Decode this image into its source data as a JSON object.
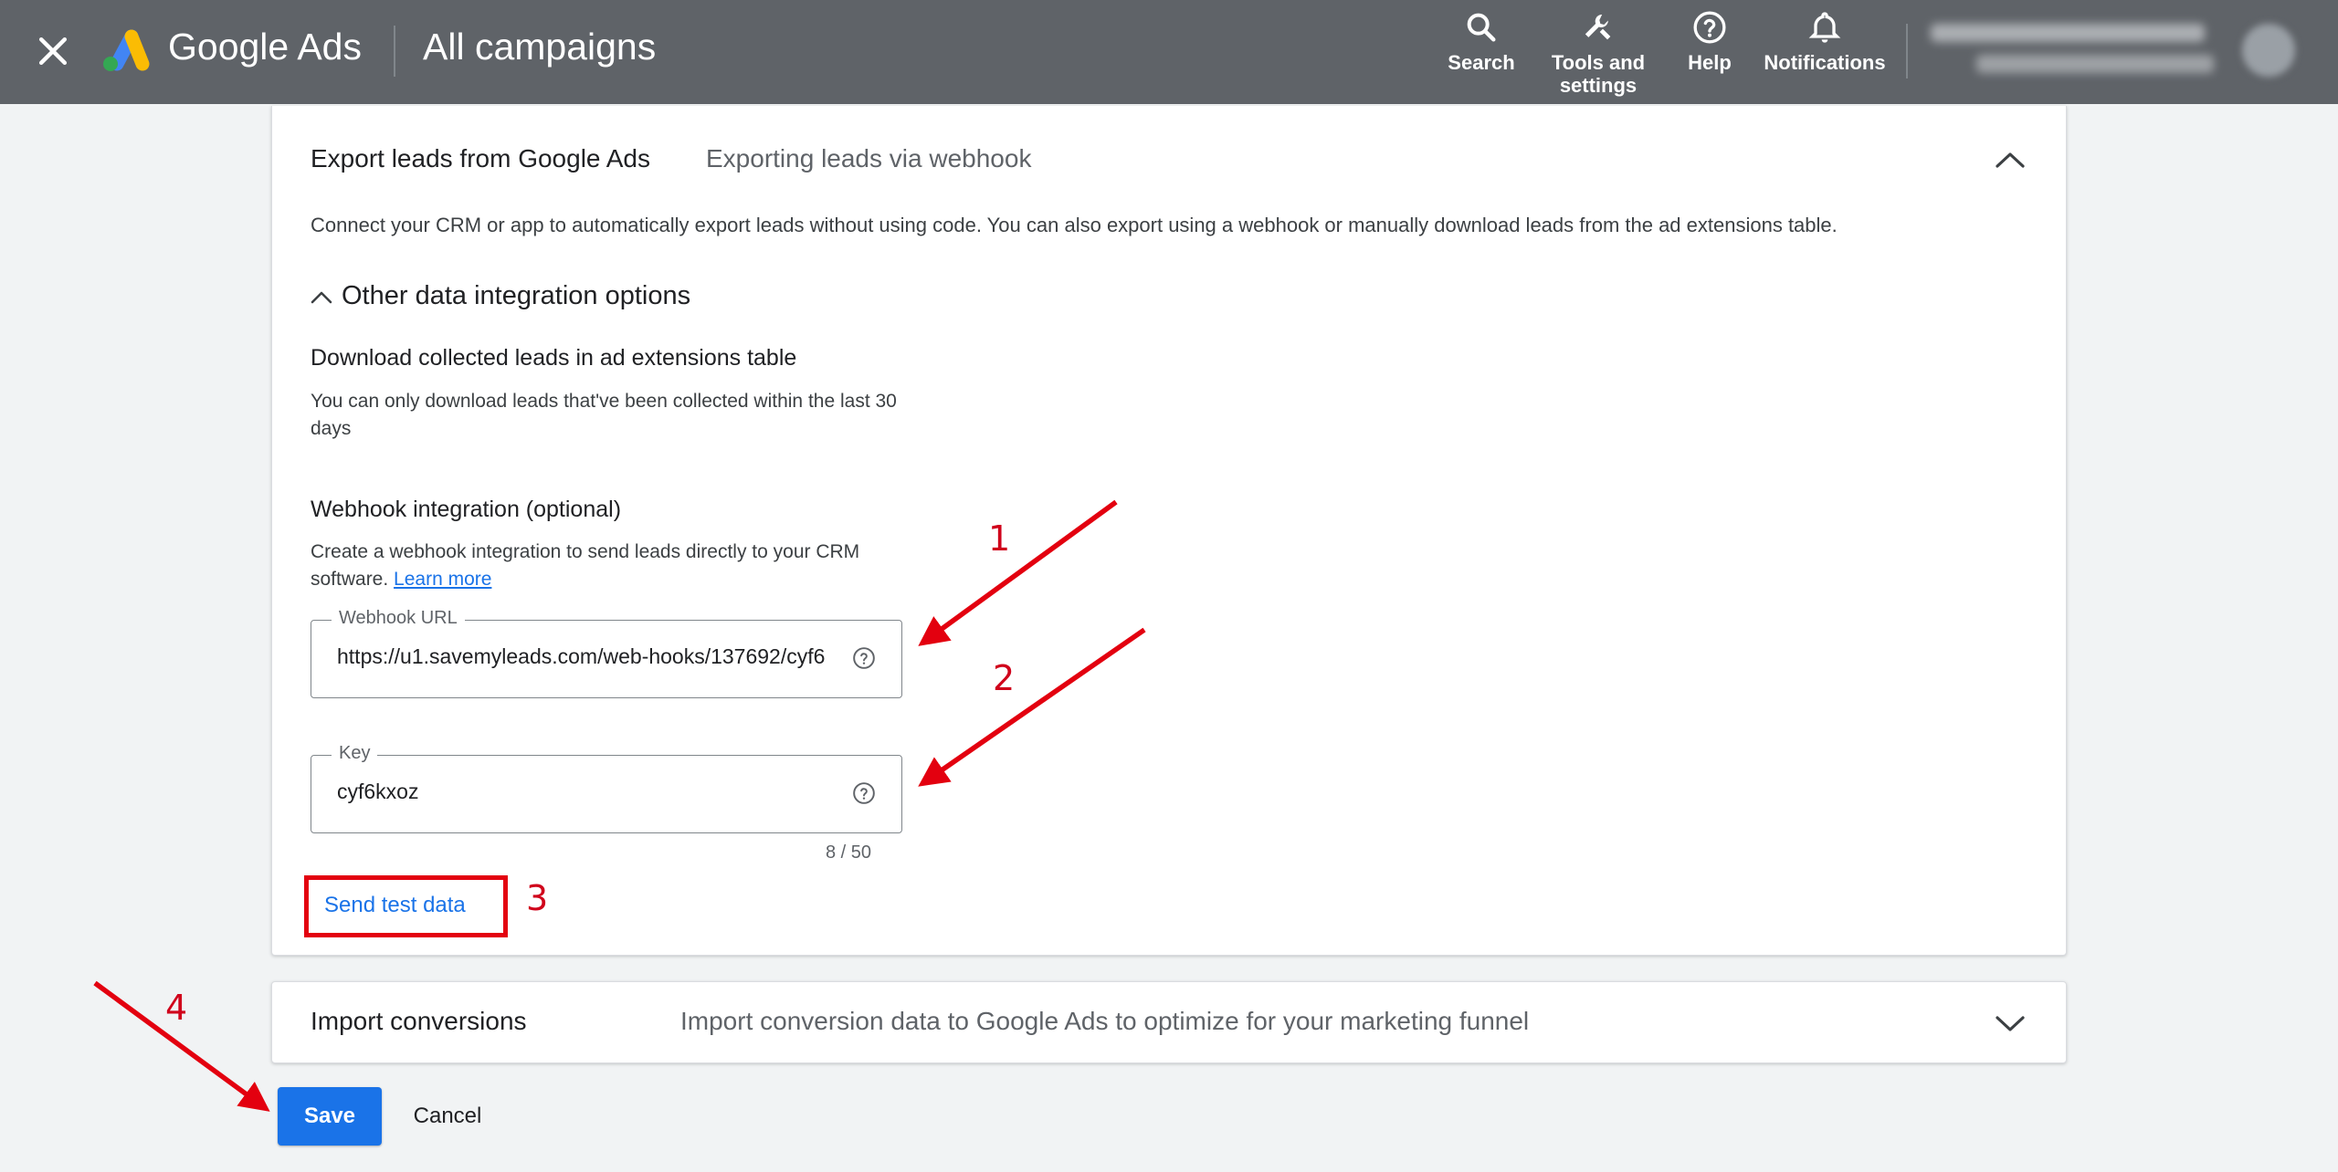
{
  "topbar": {
    "brand": "Google Ads",
    "page_title": "All campaigns",
    "tools": [
      {
        "label": "Search",
        "icon": "search-icon"
      },
      {
        "label": "Tools and\nsettings",
        "icon": "wrench-icon"
      },
      {
        "label": "Help",
        "icon": "help-icon"
      },
      {
        "label": "Notifications",
        "icon": "bell-icon"
      }
    ]
  },
  "export_card": {
    "title": "Export leads from Google Ads",
    "subtitle": "Exporting leads via webhook",
    "description": "Connect your CRM or app to automatically export leads without using code. You can also export using a webhook or manually download leads from the ad extensions table.",
    "other_options_label": "Other data integration options",
    "download": {
      "heading": "Download collected leads in ad extensions table",
      "text": "You can only download leads that've been collected within the last 30 days"
    },
    "webhook": {
      "heading": "Webhook integration (optional)",
      "text": "Create a webhook integration to send leads directly to your CRM software.",
      "learn_more": "Learn more",
      "url_label": "Webhook URL",
      "url_value": "https://u1.savemyleads.com/web-hooks/137692/cyf6",
      "key_label": "Key",
      "key_value": "cyf6kxoz",
      "key_counter": "8 / 50",
      "send_test_label": "Send test data"
    }
  },
  "import_card": {
    "title": "Import conversions",
    "subtitle": "Import conversion data to Google Ads to optimize for your marketing funnel"
  },
  "actions": {
    "save_label": "Save",
    "cancel_label": "Cancel"
  },
  "annotations": {
    "numbers": [
      "1",
      "2",
      "3",
      "4"
    ],
    "color": "#e3000f"
  },
  "colors": {
    "topbar": "#5f6368",
    "primary": "#1a73e8",
    "background": "#f1f3f4"
  }
}
